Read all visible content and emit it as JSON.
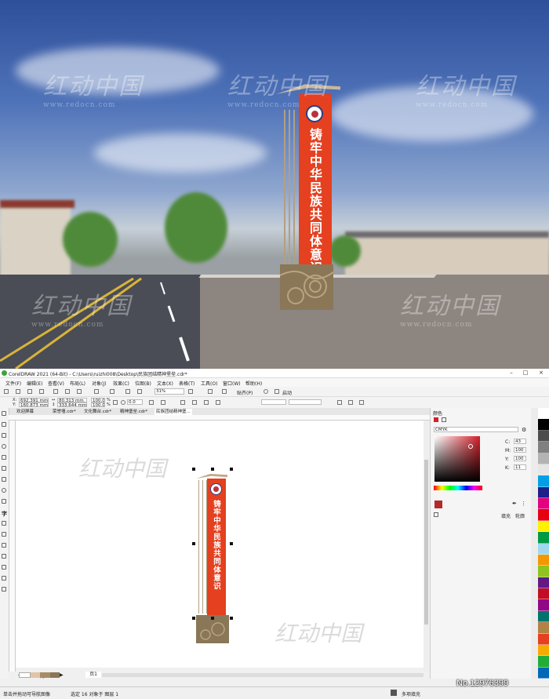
{
  "photo": {
    "monument_text": "铸牢中华民族共同体意识",
    "watermark_brand": "红动中国",
    "watermark_url": "www.redocn.com"
  },
  "app": {
    "title": "CorelDRAW 2021 (64-Bit) - C:\\Users\\ruizhi008\\Desktop\\民族团结精神堡垒.cdr*",
    "menu": [
      "文件(F)",
      "编辑(E)",
      "查看(V)",
      "布局(L)",
      "对象(J)",
      "效果(C)",
      "位图(B)",
      "文本(X)",
      "表格(T)",
      "工具(O)",
      "窗口(W)",
      "帮助(H)"
    ],
    "toolbar": {
      "zoom": "31%",
      "snap_label": "贴齐(P)",
      "launch_label": "启动"
    },
    "propbar": {
      "x": "692.391 mm",
      "y": "160.873 mm",
      "w": "80.313 mm",
      "h": "333.644 mm",
      "scale_w": "100.0",
      "scale_h": "100.0",
      "unit": "%",
      "angle": "0.0"
    },
    "tabs": [
      "欢迎屏幕",
      "荣誉墙.cdr*",
      "文化舞台.cdr*",
      "精神堡垒.cdr*",
      "民族团结精神堡..."
    ],
    "active_tab_index": 4,
    "canvas": {
      "monument_text": "铸牢中华民族共同体意识"
    },
    "pagenav": {
      "page_count": "1 的 1",
      "page_label": "页1"
    },
    "docker": {
      "title": "颜色",
      "model": "CMYK",
      "c_label": "C:",
      "c": "43",
      "m_label": "M:",
      "m": "100",
      "y_label": "Y:",
      "y": "100",
      "k_label": "K:",
      "k": "11",
      "fill_label": "填充",
      "outline_label": "轮廓"
    },
    "status": {
      "hint": "单击并拖动可导航图像",
      "selection": "选定 16 对象于 图层 1",
      "outline": "多项填充"
    },
    "colors": {
      "accent_red": "#e5401f",
      "swatch": "#b32a2d"
    }
  },
  "image_id": "No.12976399"
}
